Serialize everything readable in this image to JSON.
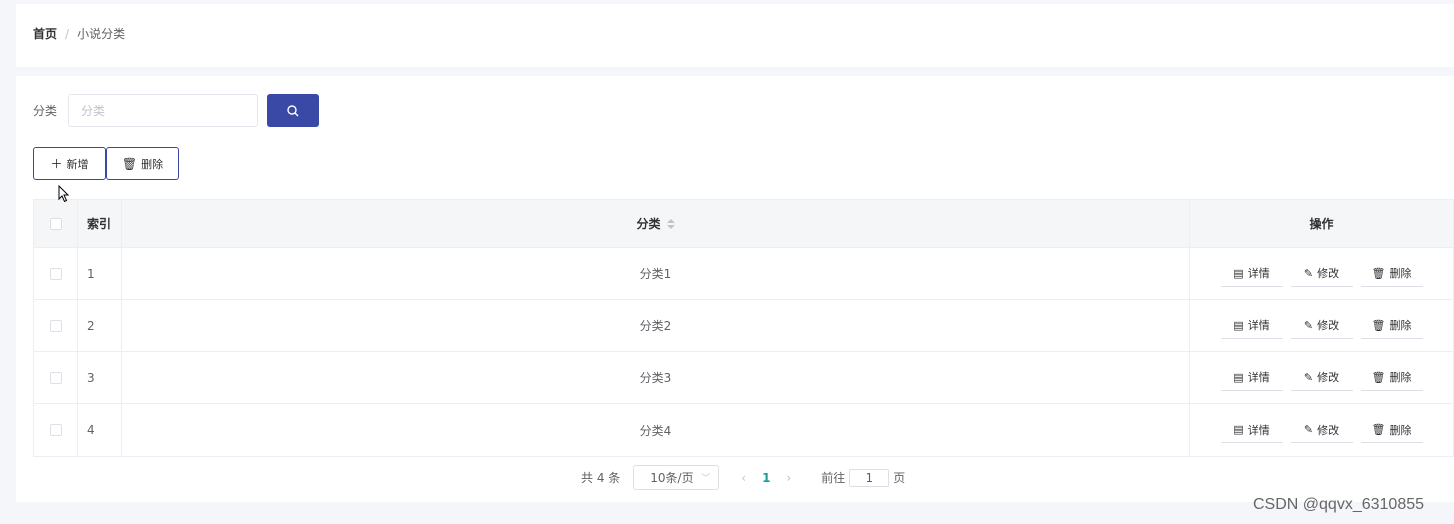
{
  "breadcrumb": {
    "home": "首页",
    "separator": "/",
    "current": "小说分类"
  },
  "search": {
    "label": "分类",
    "placeholder": "分类",
    "button_icon": "search-icon"
  },
  "actions": {
    "add_label": "新增",
    "add_icon": "plus-icon",
    "delete_label": "删除",
    "delete_icon": "trash-icon"
  },
  "table": {
    "headers": {
      "index": "索引",
      "category": "分类",
      "operations": "操作"
    },
    "rows": [
      {
        "index": "1",
        "category": "分类1"
      },
      {
        "index": "2",
        "category": "分类2"
      },
      {
        "index": "3",
        "category": "分类3"
      },
      {
        "index": "4",
        "category": "分类4"
      }
    ],
    "row_actions": {
      "detail": "详情",
      "edit": "修改",
      "delete": "删除"
    }
  },
  "pagination": {
    "total": "共 4 条",
    "page_size": "10条/页",
    "current_page": "1",
    "goto_prefix": "前往",
    "goto_value": "1",
    "goto_suffix": "页"
  },
  "watermark": "CSDN @qqvx_6310855",
  "colors": {
    "primary": "#3a48a6",
    "active_page": "#1e9c9c",
    "background": "#f4f6f9"
  }
}
